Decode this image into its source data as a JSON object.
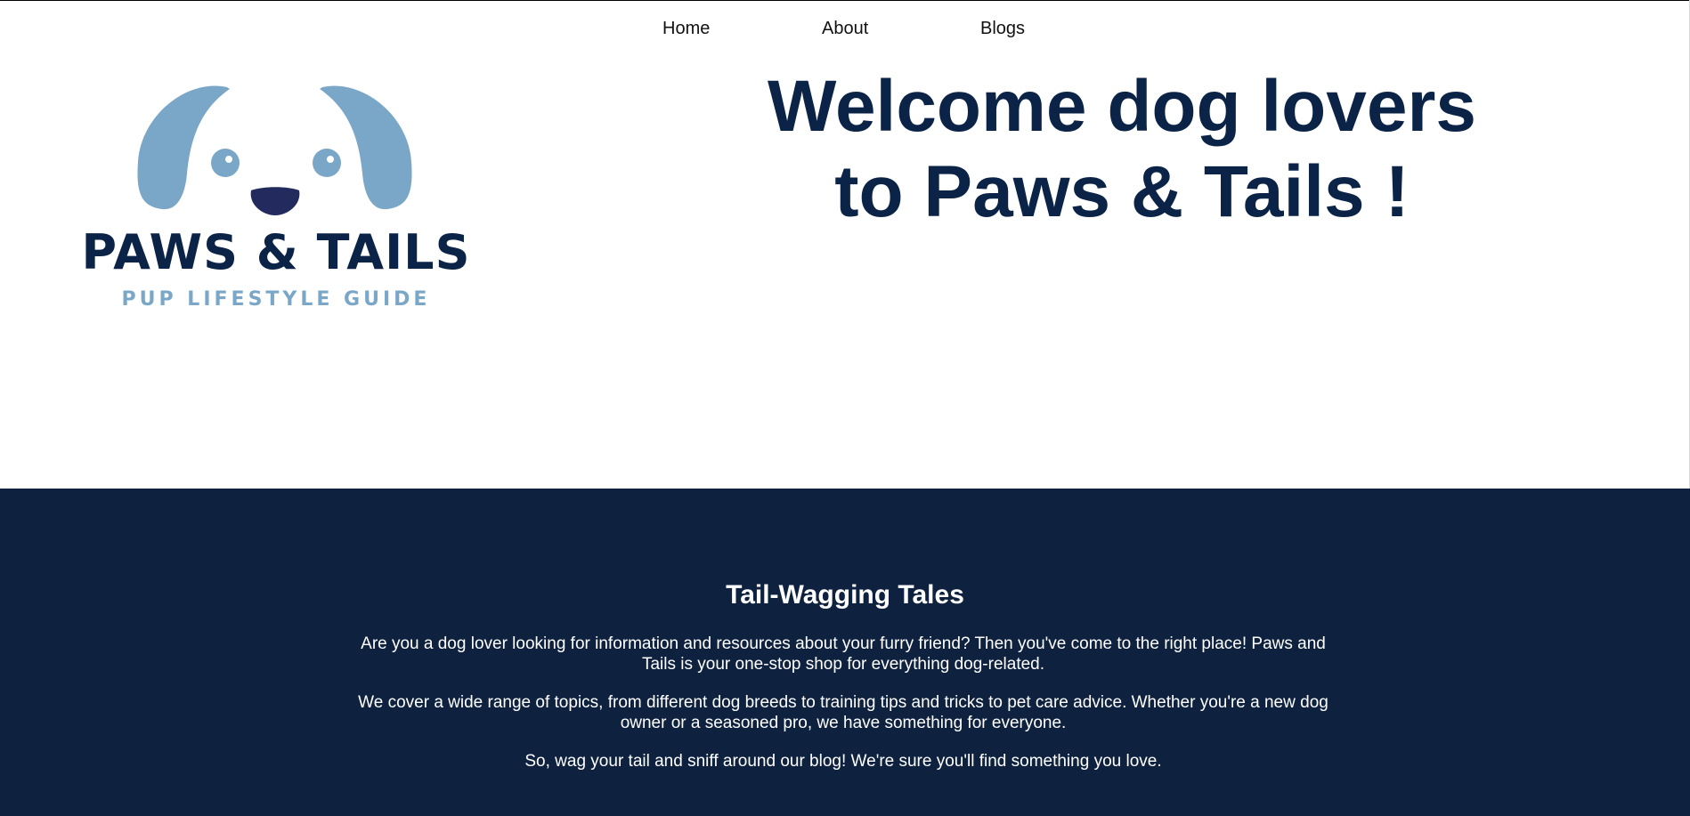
{
  "nav": {
    "items": [
      {
        "label": "Home"
      },
      {
        "label": "About"
      },
      {
        "label": "Blogs"
      }
    ]
  },
  "logo": {
    "brand_name": "PAWS & TAILS",
    "tagline": "PUP LIFESTYLE GUIDE",
    "colors": {
      "ears": "#7aa7c8",
      "nose": "#232b5e",
      "wordmark": "#0b2347",
      "tagline": "#7aa7c8"
    }
  },
  "hero": {
    "title": "Welcome dog lovers to Paws & Tails !",
    "title_color": "#0b2347"
  },
  "tales": {
    "background": "#0e2240",
    "title": "Tail-Wagging Tales",
    "paragraphs": [
      "Are you a dog lover looking for information and resources about your furry friend? Then you've come to the right place! Paws and Tails is your one-stop shop for everything dog-related.",
      "We cover a wide range of topics, from different dog breeds to training tips and tricks to pet care advice. Whether you're a new dog owner or a seasoned pro, we have something for everyone.",
      "So, wag your tail and sniff around our blog! We're sure you'll find something you love."
    ]
  }
}
